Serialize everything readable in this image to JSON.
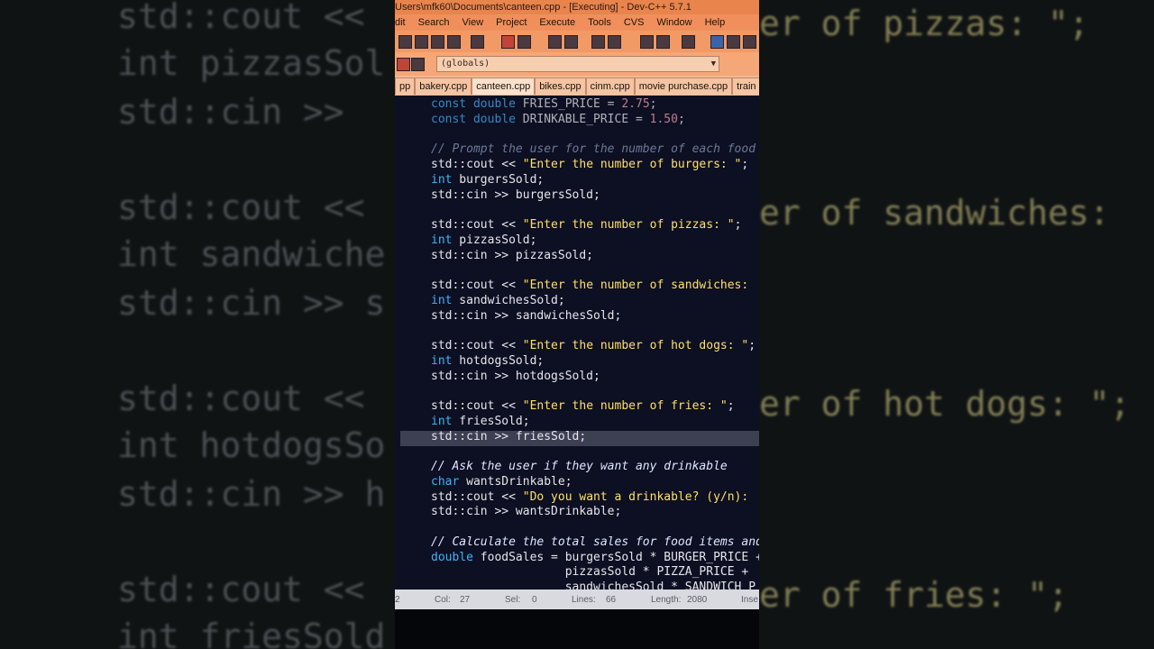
{
  "window": {
    "title": "Users\\mfk60\\Documents\\canteen.cpp - [Executing] - Dev-C++ 5.7.1"
  },
  "menu": [
    "dit",
    "Search",
    "View",
    "Project",
    "Execute",
    "Tools",
    "CVS",
    "Window",
    "Help"
  ],
  "toolbar": {
    "globals_dropdown": "(globals)"
  },
  "tabs": [
    "pp",
    "bakery.cpp",
    "canteen.cpp",
    "bikes.cpp",
    "cinm.cpp",
    "movie purchase.cpp",
    "train rou"
  ],
  "active_tab": "canteen.cpp",
  "code_lines": [
    {
      "text": "const double FRIES_PRICE = 2.75;"
    },
    {
      "text": "const double DRINKABLE_PRICE = 1.50;"
    },
    {
      "text": ""
    },
    {
      "text": "// Prompt the user for the number of each food"
    },
    {
      "text": "std::cout << \"Enter the number of burgers: \";"
    },
    {
      "text": "int burgersSold;"
    },
    {
      "text": "std::cin >> burgersSold;"
    },
    {
      "text": ""
    },
    {
      "text": "std::cout << \"Enter the number of pizzas: \";"
    },
    {
      "text": "int pizzasSold;"
    },
    {
      "text": "std::cin >> pizzasSold;"
    },
    {
      "text": ""
    },
    {
      "text": "std::cout << \"Enter the number of sandwiches: "
    },
    {
      "text": "int sandwichesSold;"
    },
    {
      "text": "std::cin >> sandwichesSold;"
    },
    {
      "text": ""
    },
    {
      "text": "std::cout << \"Enter the number of hot dogs: \";"
    },
    {
      "text": "int hotdogsSold;"
    },
    {
      "text": "std::cin >> hotdogsSold;"
    },
    {
      "text": ""
    },
    {
      "text": "std::cout << \"Enter the number of fries: \";"
    },
    {
      "text": "int friesSold;"
    },
    {
      "text": "std::cin >> friesSold;"
    },
    {
      "text": ""
    },
    {
      "text": "// Ask the user if they want any drinkable"
    },
    {
      "text": "char wantsDrinkable;"
    },
    {
      "text": "std::cout << \"Do you want a drinkable? (y/n): "
    },
    {
      "text": "std::cin >> wantsDrinkable;"
    },
    {
      "text": ""
    },
    {
      "text": "// Calculate the total sales for food items and"
    },
    {
      "text": "double foodSales = burgersSold * BURGER_PRICE +"
    },
    {
      "text": "                   pizzasSold * PIZZA_PRICE +"
    },
    {
      "text": "                   sandwichesSold * SANDWICH_P"
    }
  ],
  "statusbar": {
    "line": "2",
    "col_label": "Col:",
    "col": "27",
    "sel_label": "Sel:",
    "sel": "0",
    "lines_label": "Lines:",
    "lines": "66",
    "length_label": "Length:",
    "length": "2080",
    "mode": "Inse"
  },
  "background_left": [
    "std::cout <<",
    "int pizzasSol",
    "std::cin >> ",
    "",
    "std::cout <<",
    "int sandwiche",
    "std::cin >> s",
    "",
    "std::cout <<",
    "int hotdogsSo",
    "std::cin >> h",
    "",
    "std::cout <<",
    "int friesSold"
  ],
  "background_right": [
    "er of pizzas: \";",
    "er of sandwiches:",
    "er of hot dogs: \";",
    "er of fries: \";"
  ]
}
